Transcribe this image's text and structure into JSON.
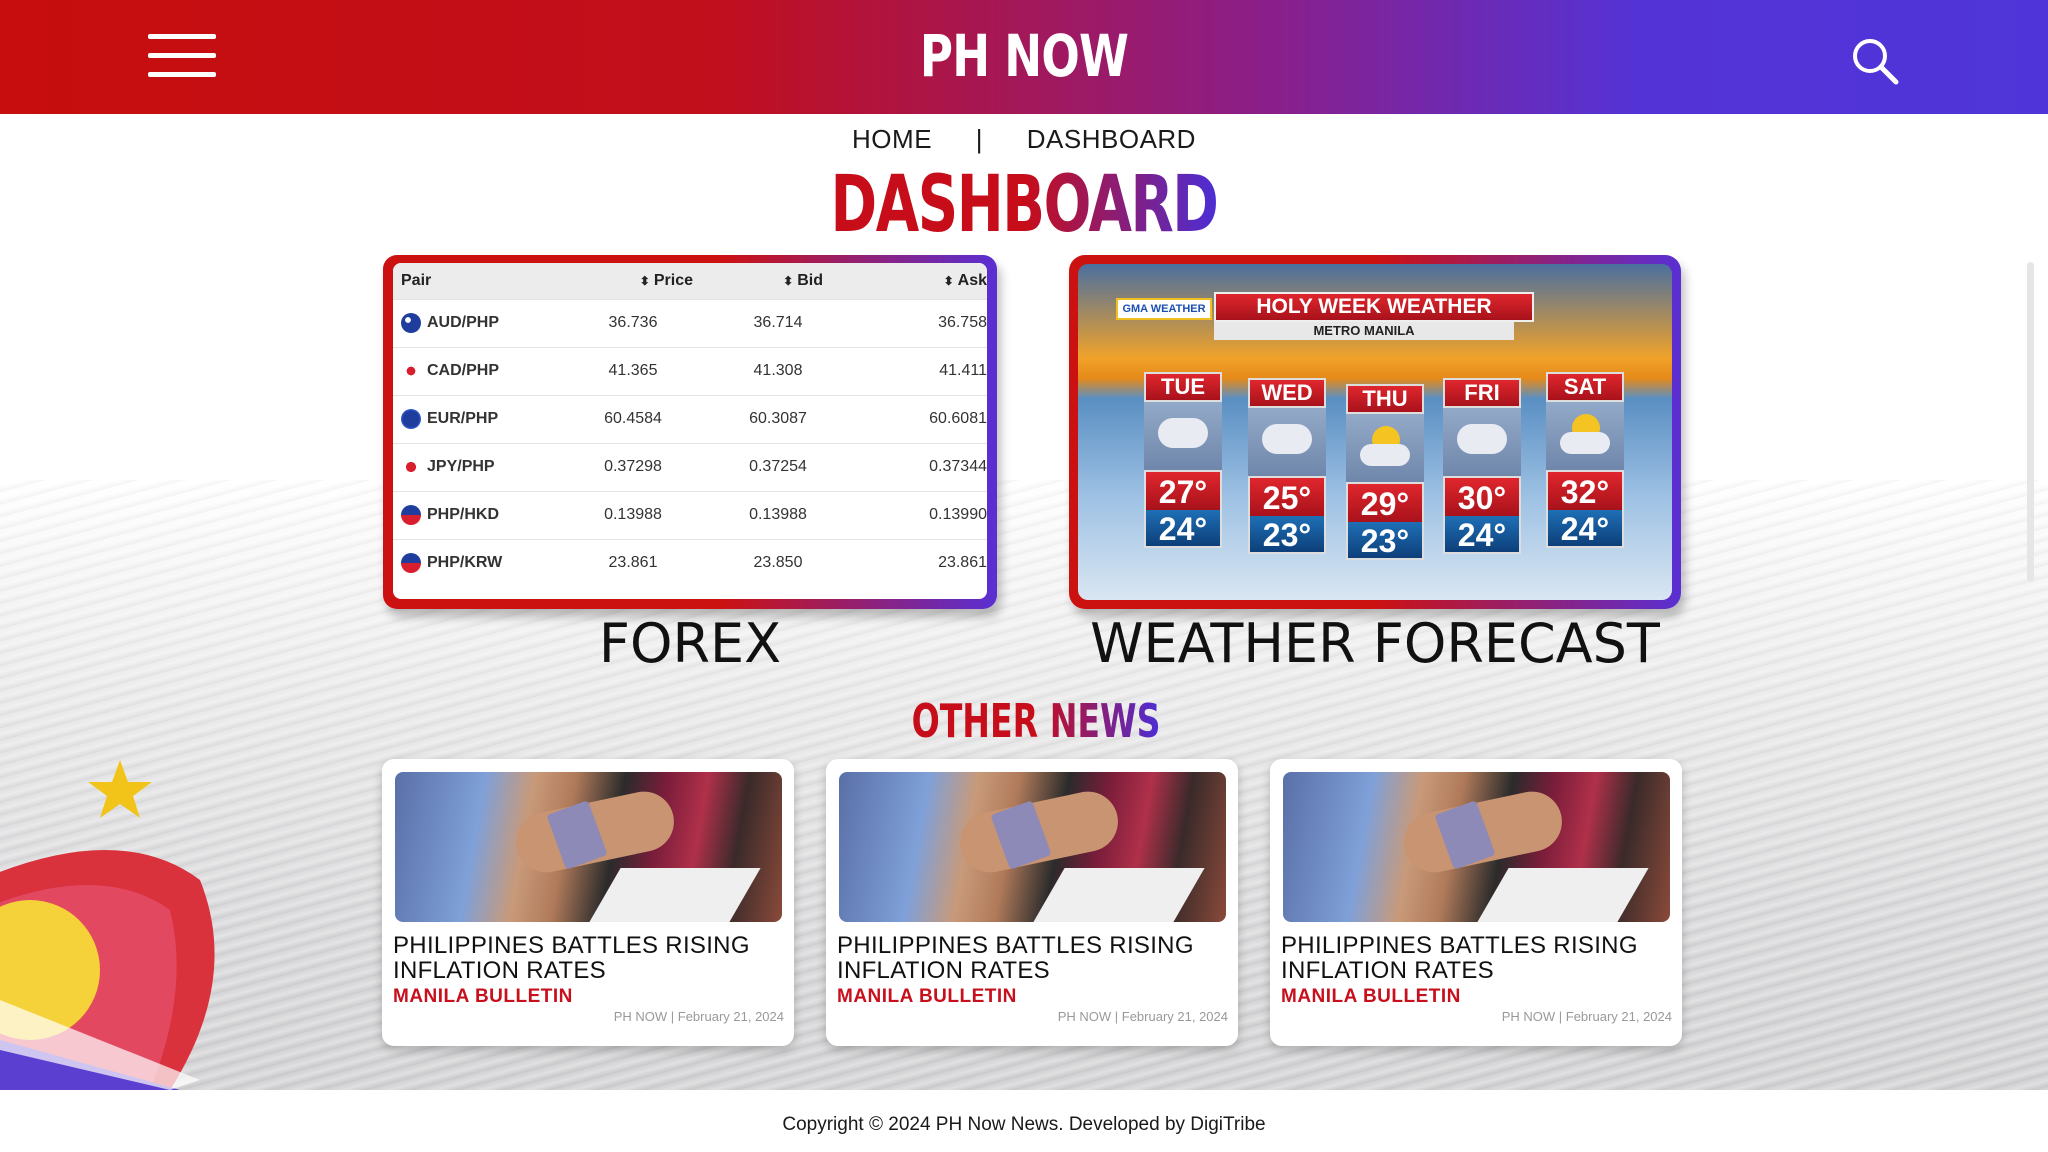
{
  "header": {
    "brand": "PH NOW",
    "menu_icon": "hamburger-menu-icon",
    "search_icon": "search-icon"
  },
  "breadcrumb": {
    "home": "HOME",
    "separator": "|",
    "current": "DASHBOARD"
  },
  "page_title": "DASHBOARD",
  "forex": {
    "label": "FOREX",
    "columns": [
      "Pair",
      "Price",
      "Bid",
      "Ask"
    ],
    "rows": [
      {
        "pair": "AUD/PHP",
        "price": "36.736",
        "bid": "36.714",
        "ask": "36.758"
      },
      {
        "pair": "CAD/PHP",
        "price": "41.365",
        "bid": "41.308",
        "ask": "41.411"
      },
      {
        "pair": "EUR/PHP",
        "price": "60.4584",
        "bid": "60.3087",
        "ask": "60.6081"
      },
      {
        "pair": "JPY/PHP",
        "price": "0.37298",
        "bid": "0.37254",
        "ask": "0.37344"
      },
      {
        "pair": "PHP/HKD",
        "price": "0.13988",
        "bid": "0.13988",
        "ask": "0.13990"
      },
      {
        "pair": "PHP/KRW",
        "price": "23.861",
        "bid": "23.850",
        "ask": "23.861"
      }
    ]
  },
  "weather": {
    "label": "WEATHER FORECAST",
    "logo": "GMA WEATHER",
    "banner": "HOLY WEEK WEATHER",
    "location": "METRO MANILA",
    "days": [
      {
        "name": "TUE",
        "hi": "27°",
        "lo": "24°",
        "icon": "cloud-rain-icon"
      },
      {
        "name": "WED",
        "hi": "25°",
        "lo": "23°",
        "icon": "cloud-rain-icon"
      },
      {
        "name": "THU",
        "hi": "29°",
        "lo": "23°",
        "icon": "sun-cloud-icon"
      },
      {
        "name": "FRI",
        "hi": "30°",
        "lo": "24°",
        "icon": "cloud-rain-icon"
      },
      {
        "name": "SAT",
        "hi": "32°",
        "lo": "24°",
        "icon": "sun-cloud-icon"
      }
    ]
  },
  "news": {
    "section_title": "OTHER NEWS",
    "items": [
      {
        "headline": "PHILIPPINES BATTLES RISING INFLATION RATES",
        "source": "MANILA BULLETIN",
        "meta": "PH NOW | February 21, 2024"
      },
      {
        "headline": "PHILIPPINES BATTLES RISING INFLATION RATES",
        "source": "MANILA BULLETIN",
        "meta": "PH NOW | February 21, 2024"
      },
      {
        "headline": "PHILIPPINES BATTLES RISING INFLATION RATES",
        "source": "MANILA BULLETIN",
        "meta": "PH NOW | February 21, 2024"
      }
    ]
  },
  "footer": {
    "text": "Copyright © 2024 PH Now News. Developed by DigiTribe"
  },
  "colors": {
    "brand_red": "#c70d0d",
    "brand_purple": "#4f35d9",
    "source_red": "#c8101d"
  }
}
